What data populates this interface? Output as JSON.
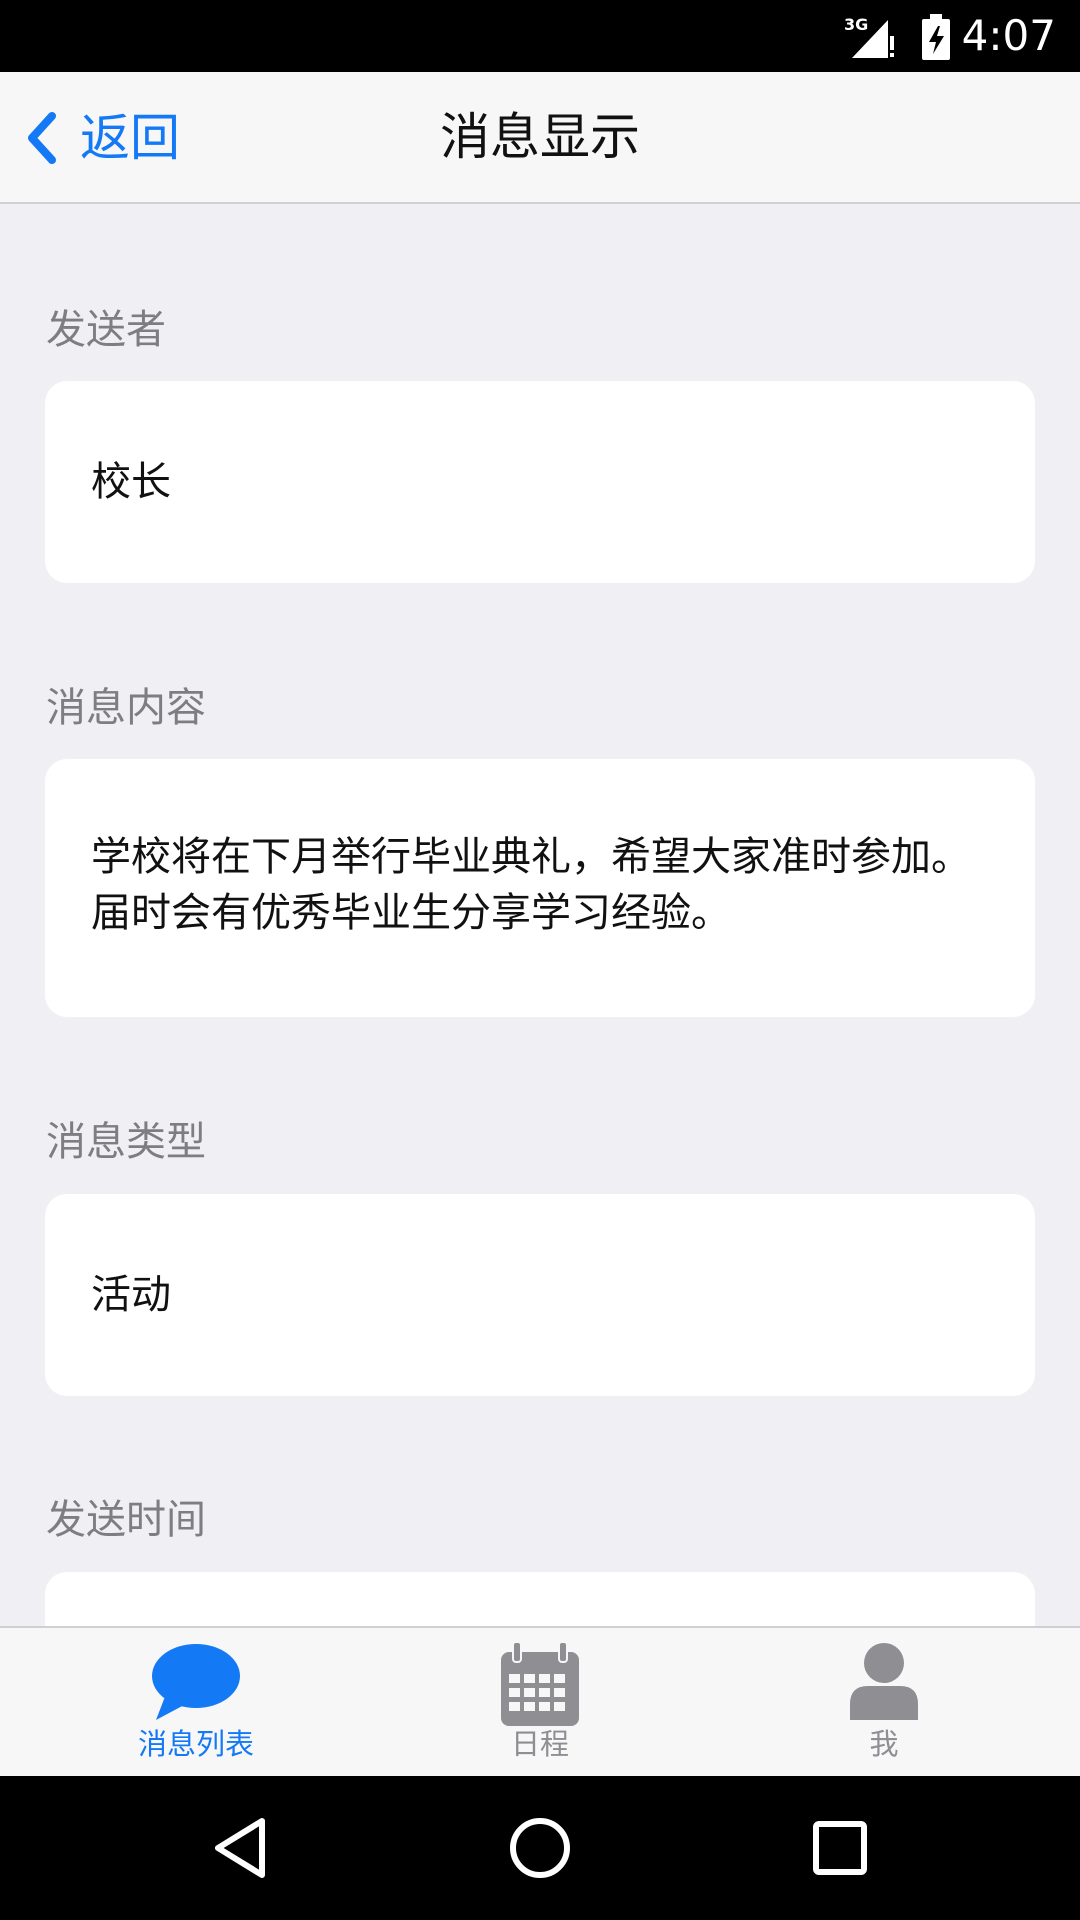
{
  "status_bar": {
    "network": "3G",
    "time": "4:07"
  },
  "nav": {
    "back_label": "返回",
    "title": "消息显示"
  },
  "sections": [
    {
      "label": "发送者",
      "value": "校长"
    },
    {
      "label": "消息内容",
      "value": "学校将在下月举行毕业典礼，希望大家准时参加。届时会有优秀毕业生分享学习经验。"
    },
    {
      "label": "消息类型",
      "value": "活动"
    },
    {
      "label": "发送时间",
      "value": ""
    }
  ],
  "tabs": [
    {
      "label": "消息列表",
      "icon": "chat-bubble-icon",
      "active": true
    },
    {
      "label": "日程",
      "icon": "calendar-icon",
      "active": false
    },
    {
      "label": "我",
      "icon": "person-icon",
      "active": false
    }
  ],
  "colors": {
    "accent": "#1479f5",
    "background": "#efeff4",
    "inactive": "#8e8e93"
  }
}
